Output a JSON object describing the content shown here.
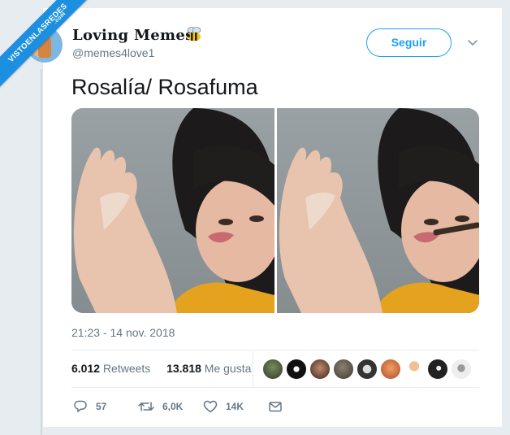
{
  "watermark": {
    "text": "VISTOENLASREDES",
    "suffix": ".com"
  },
  "tweet": {
    "author_name": "Loving Memes",
    "author_emoji_icon": "bee-icon",
    "handle": "@memes4love1",
    "follow_label": "Seguir",
    "text": "Rosalía/ Rosafuma",
    "timestamp": "21:23 - 14 nov. 2018",
    "retweets_count": "6.012",
    "retweets_label": "Retweets",
    "likes_count": "13.818",
    "likes_label": "Me gusta",
    "reply_count": "57",
    "retweet_action_count": "6,0K",
    "like_action_count": "14K"
  },
  "colors": {
    "accent": "#1da1f2",
    "muted": "#657786",
    "text": "#14171a",
    "background": "#e6ecf0",
    "watermark": "#1d8fe0"
  }
}
